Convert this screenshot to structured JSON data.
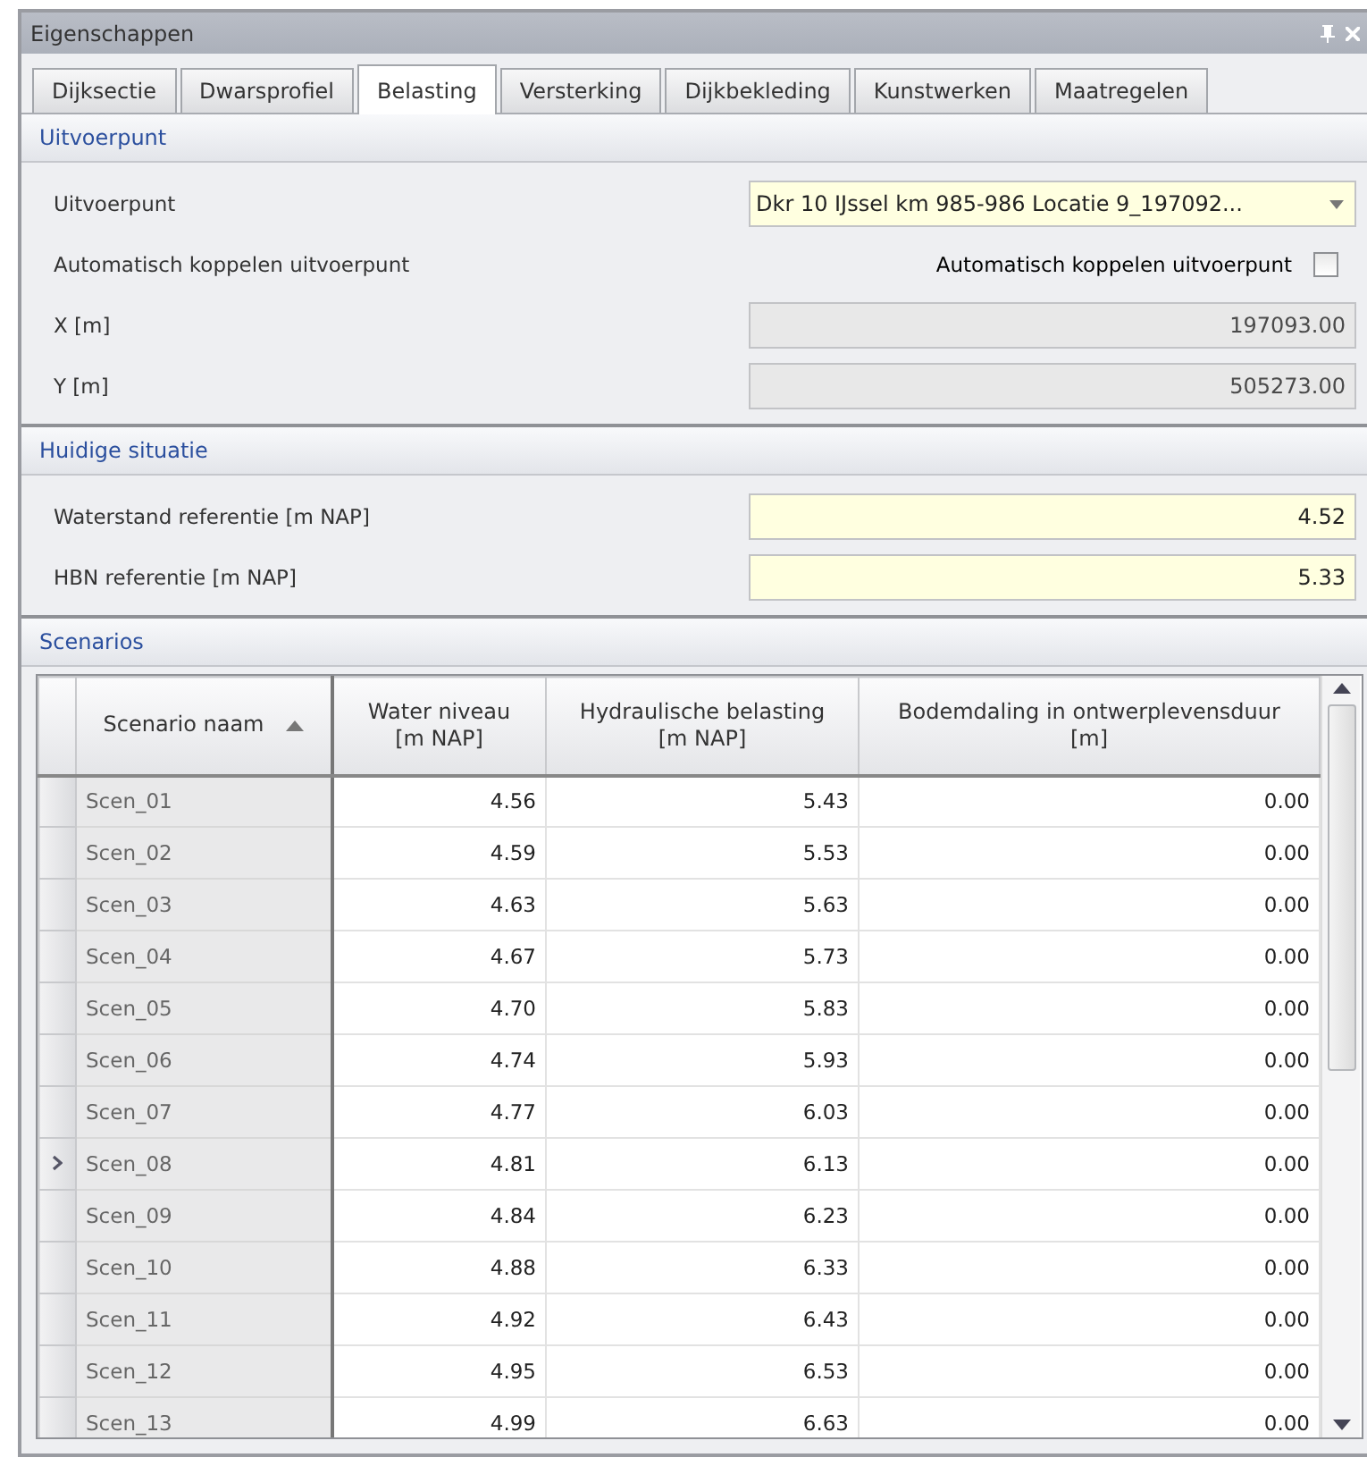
{
  "window": {
    "title": "Eigenschappen"
  },
  "tabs": [
    {
      "label": "Dijksectie",
      "selected": false
    },
    {
      "label": "Dwarsprofiel",
      "selected": false
    },
    {
      "label": "Belasting",
      "selected": true
    },
    {
      "label": "Versterking",
      "selected": false
    },
    {
      "label": "Dijkbekleding",
      "selected": false
    },
    {
      "label": "Kunstwerken",
      "selected": false
    },
    {
      "label": "Maatregelen",
      "selected": false
    }
  ],
  "sections": [
    {
      "title": "Uitvoerpunt",
      "rows": [
        {
          "kind": "dropdown",
          "label": "Uitvoerpunt",
          "value": "Dkr 10 IJssel km 985-986 Locatie  9_197092...",
          "readonly": false
        },
        {
          "kind": "checkbox",
          "label": "Automatisch koppelen uitvoerpunt",
          "caption": "Automatisch koppelen uitvoerpunt",
          "checked": false
        },
        {
          "kind": "text",
          "label": "X [m]",
          "value": "197093.00",
          "readonly": true
        },
        {
          "kind": "text",
          "label": "Y [m]",
          "value": "505273.00",
          "readonly": true
        }
      ]
    },
    {
      "title": "Huidige situatie",
      "rows": [
        {
          "kind": "text",
          "label": "Waterstand referentie [m NAP]",
          "value": "4.52",
          "readonly": false
        },
        {
          "kind": "text",
          "label": "HBN referentie [m NAP]",
          "value": "5.33",
          "readonly": false
        }
      ]
    }
  ],
  "scenarios": {
    "title": "Scenarios",
    "columns": [
      {
        "label": "Scenario naam",
        "sorted": true
      },
      {
        "label": "Water niveau\n[m NAP]",
        "sorted": false
      },
      {
        "label": "Hydraulische belasting\n[m NAP]",
        "sorted": false
      },
      {
        "label": "Bodemdaling in ontwerplevensduur\n[m]",
        "sorted": false
      }
    ],
    "rows": [
      {
        "cells": [
          "Scen_01",
          "4.56",
          "5.43",
          "0.00"
        ],
        "selected": false
      },
      {
        "cells": [
          "Scen_02",
          "4.59",
          "5.53",
          "0.00"
        ],
        "selected": false
      },
      {
        "cells": [
          "Scen_03",
          "4.63",
          "5.63",
          "0.00"
        ],
        "selected": false
      },
      {
        "cells": [
          "Scen_04",
          "4.67",
          "5.73",
          "0.00"
        ],
        "selected": false
      },
      {
        "cells": [
          "Scen_05",
          "4.70",
          "5.83",
          "0.00"
        ],
        "selected": false
      },
      {
        "cells": [
          "Scen_06",
          "4.74",
          "5.93",
          "0.00"
        ],
        "selected": false
      },
      {
        "cells": [
          "Scen_07",
          "4.77",
          "6.03",
          "0.00"
        ],
        "selected": false
      },
      {
        "cells": [
          "Scen_08",
          "4.81",
          "6.13",
          "0.00"
        ],
        "selected": true
      },
      {
        "cells": [
          "Scen_09",
          "4.84",
          "6.23",
          "0.00"
        ],
        "selected": false
      },
      {
        "cells": [
          "Scen_10",
          "4.88",
          "6.33",
          "0.00"
        ],
        "selected": false
      },
      {
        "cells": [
          "Scen_11",
          "4.92",
          "6.43",
          "0.00"
        ],
        "selected": false
      },
      {
        "cells": [
          "Scen_12",
          "4.95",
          "6.53",
          "0.00"
        ],
        "selected": false
      },
      {
        "cells": [
          "Scen_13",
          "4.99",
          "6.63",
          "0.00"
        ],
        "selected": false
      }
    ]
  }
}
